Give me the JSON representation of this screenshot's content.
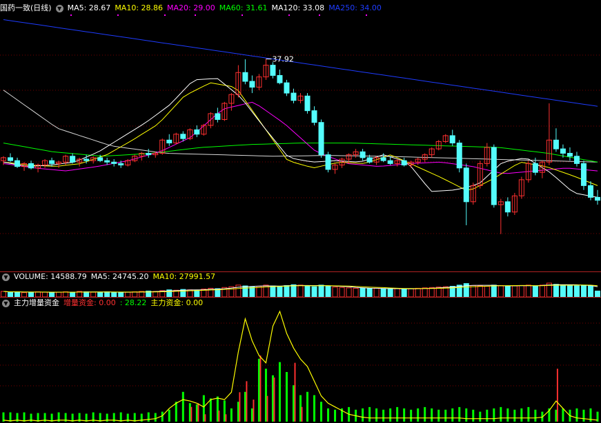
{
  "main_header": {
    "title": "国药一致(日线)",
    "items": [
      {
        "label": "MA5: 28.67",
        "color": "#ffffff"
      },
      {
        "label": "MA10: 28.86",
        "color": "#ffff00"
      },
      {
        "label": "MA20: 29.00",
        "color": "#ff00ff"
      },
      {
        "label": "MA60: 31.61",
        "color": "#00ff00"
      },
      {
        "label": "MA120: 33.08",
        "color": "#ffffff"
      },
      {
        "label": "MA250: 34.00",
        "color": "#1e3cff"
      }
    ]
  },
  "volume_header": {
    "title": "VOLUME: 14588.79",
    "items": [
      {
        "label": "MA5: 24745.20",
        "color": "#ffffff"
      },
      {
        "label": "MA10: 27991.57",
        "color": "#ffff00"
      }
    ]
  },
  "indicator_header": {
    "title": "主力增量资金",
    "items": [
      {
        "label": "增量资金: 0.00",
        "color": "#ff3030"
      },
      {
        "label": ": 28.22",
        "color": "#00ff00"
      },
      {
        "label": "主力资金: 0.00",
        "color": "#ffff00"
      }
    ]
  },
  "colors": {
    "up": "#ff3030",
    "down": "#54fcfc",
    "grid": "#7a0000",
    "ma5": "#ffffff",
    "ma10": "#ffff00",
    "ma20": "#ff00ff",
    "ma60": "#00ff00",
    "ma120": "#d8d8d8",
    "ma250": "#1e3cff"
  },
  "chart_data": [
    {
      "type": "candlestick",
      "series_name": "国药一致(日线)",
      "ylim": [
        23.5,
        41
      ],
      "grid": true,
      "annotations": [
        {
          "text": "37.92",
          "at_bar": 38
        }
      ],
      "ohlc": [
        [
          31.0,
          31.3,
          30.7,
          31.2
        ],
        [
          31.2,
          31.5,
          30.9,
          31.0
        ],
        [
          31.0,
          31.2,
          30.5,
          30.6
        ],
        [
          30.6,
          30.9,
          30.3,
          30.8
        ],
        [
          30.8,
          31.0,
          30.4,
          30.5
        ],
        [
          30.5,
          30.8,
          30.2,
          30.7
        ],
        [
          30.7,
          31.1,
          30.5,
          31.0
        ],
        [
          31.0,
          31.2,
          30.6,
          30.8
        ],
        [
          30.8,
          31.0,
          30.5,
          30.9
        ],
        [
          30.9,
          31.4,
          30.7,
          31.3
        ],
        [
          31.3,
          31.5,
          30.8,
          30.9
        ],
        [
          30.9,
          31.2,
          30.6,
          31.1
        ],
        [
          31.1,
          31.4,
          30.8,
          31.0
        ],
        [
          31.0,
          31.3,
          30.8,
          31.2
        ],
        [
          31.2,
          31.4,
          30.9,
          31.0
        ],
        [
          31.0,
          31.2,
          30.7,
          30.9
        ],
        [
          30.9,
          31.1,
          30.6,
          30.8
        ],
        [
          30.8,
          31.0,
          30.5,
          30.7
        ],
        [
          30.7,
          31.1,
          30.6,
          31.0
        ],
        [
          31.0,
          31.4,
          30.9,
          31.3
        ],
        [
          31.3,
          31.6,
          31.0,
          31.5
        ],
        [
          31.5,
          31.8,
          31.2,
          31.4
        ],
        [
          31.4,
          31.6,
          31.2,
          31.5
        ],
        [
          31.5,
          32.5,
          31.4,
          32.4
        ],
        [
          32.4,
          32.8,
          32.0,
          32.2
        ],
        [
          32.2,
          32.9,
          32.1,
          32.8
        ],
        [
          32.8,
          33.0,
          32.3,
          32.5
        ],
        [
          32.5,
          33.2,
          32.4,
          33.1
        ],
        [
          33.1,
          33.4,
          32.6,
          32.8
        ],
        [
          32.8,
          33.5,
          32.7,
          33.4
        ],
        [
          33.4,
          34.3,
          33.2,
          34.2
        ],
        [
          34.2,
          34.6,
          33.6,
          33.8
        ],
        [
          33.8,
          35.0,
          33.7,
          34.9
        ],
        [
          34.9,
          35.6,
          34.4,
          35.5
        ],
        [
          35.5,
          37.5,
          35.3,
          37.0
        ],
        [
          37.0,
          37.9,
          36.2,
          36.4
        ],
        [
          36.4,
          36.8,
          35.6,
          36.0
        ],
        [
          36.0,
          36.9,
          35.8,
          36.7
        ],
        [
          36.7,
          37.92,
          36.5,
          37.5
        ],
        [
          37.5,
          37.7,
          36.6,
          36.8
        ],
        [
          36.8,
          37.2,
          36.2,
          36.3
        ],
        [
          36.3,
          36.5,
          35.4,
          35.6
        ],
        [
          35.6,
          35.9,
          34.9,
          35.1
        ],
        [
          35.1,
          35.6,
          34.9,
          35.4
        ],
        [
          35.4,
          35.6,
          34.2,
          34.4
        ],
        [
          34.4,
          34.7,
          33.4,
          33.6
        ],
        [
          33.6,
          33.8,
          31.2,
          31.4
        ],
        [
          31.4,
          31.6,
          30.2,
          30.4
        ],
        [
          30.4,
          30.8,
          30.1,
          30.7
        ],
        [
          30.7,
          31.2,
          30.5,
          31.1
        ],
        [
          31.1,
          31.5,
          30.8,
          31.4
        ],
        [
          31.4,
          31.8,
          31.2,
          31.6
        ],
        [
          31.6,
          31.8,
          31.0,
          31.2
        ],
        [
          31.2,
          31.4,
          30.8,
          30.9
        ],
        [
          30.9,
          31.3,
          30.7,
          31.2
        ],
        [
          31.2,
          31.5,
          30.9,
          31.0
        ],
        [
          31.0,
          31.3,
          30.7,
          30.8
        ],
        [
          30.8,
          31.1,
          30.6,
          31.0
        ],
        [
          31.0,
          31.2,
          30.6,
          30.7
        ],
        [
          30.7,
          31.0,
          30.5,
          30.9
        ],
        [
          30.9,
          31.2,
          30.7,
          31.1
        ],
        [
          31.1,
          31.5,
          30.9,
          31.4
        ],
        [
          31.4,
          31.9,
          31.2,
          31.8
        ],
        [
          31.8,
          32.4,
          31.7,
          32.3
        ],
        [
          32.3,
          32.8,
          32.2,
          32.7
        ],
        [
          32.7,
          33.1,
          32.0,
          32.2
        ],
        [
          32.2,
          32.4,
          30.2,
          30.5
        ],
        [
          30.5,
          30.8,
          26.6,
          28.2
        ],
        [
          28.2,
          29.5,
          28.0,
          29.3
        ],
        [
          29.3,
          31.0,
          29.1,
          30.8
        ],
        [
          30.8,
          32.2,
          30.6,
          31.9
        ],
        [
          31.9,
          32.1,
          27.8,
          28.0
        ],
        [
          28.0,
          28.4,
          26.0,
          28.2
        ],
        [
          28.2,
          28.5,
          27.2,
          27.5
        ],
        [
          27.5,
          28.8,
          27.3,
          28.6
        ],
        [
          28.6,
          29.9,
          28.4,
          29.7
        ],
        [
          29.7,
          31.0,
          29.5,
          30.8
        ],
        [
          30.8,
          31.2,
          30.0,
          30.2
        ],
        [
          30.2,
          31.0,
          29.8,
          30.9
        ],
        [
          30.9,
          34.9,
          30.7,
          32.4
        ],
        [
          32.4,
          33.2,
          31.6,
          31.8
        ],
        [
          31.8,
          32.1,
          31.2,
          31.5
        ],
        [
          31.5,
          31.9,
          31.0,
          31.3
        ],
        [
          31.3,
          31.6,
          30.6,
          30.8
        ],
        [
          30.8,
          31.0,
          29.0,
          29.3
        ],
        [
          29.3,
          29.6,
          28.3,
          28.5
        ],
        [
          28.5,
          29.0,
          28.0,
          28.3
        ]
      ],
      "ma": {
        "MA250": [
          40.6,
          34.7
        ],
        "MA120": [
          35.8,
          33.2,
          32.0,
          31.5,
          31.4,
          31.3,
          31.35,
          31.3,
          31.2,
          31.1,
          31.0,
          30.9
        ],
        "MA60": [
          32.2,
          31.6,
          31.3,
          31.5,
          31.9,
          32.1,
          32.2,
          32.2,
          32.1,
          32.0,
          31.9,
          31.5,
          30.9
        ],
        "MA20": [
          30.8,
          30.5,
          30.3,
          30.6,
          31.0,
          31.6,
          32.6,
          34.5,
          35.0,
          33.5,
          31.6,
          30.8,
          30.6,
          30.8,
          30.9,
          30.6,
          30.1,
          30.3,
          30.5,
          30.3
        ],
        "MA10": [
          30.9,
          30.7,
          30.6,
          30.8,
          31.4,
          32.4,
          33.5,
          35.4,
          36.3,
          36.0,
          33.5,
          31.0,
          30.5,
          30.9,
          30.8,
          31.4,
          30.6,
          29.8,
          28.9,
          29.8,
          30.9,
          30.6,
          30.0,
          29.3
        ],
        "MA5": [
          30.9,
          30.6,
          30.7,
          30.9,
          31.6,
          32.6,
          33.6,
          34.8,
          36.5,
          36.6,
          35.3,
          33.2,
          31.2,
          30.9,
          31.0,
          30.9,
          31.4,
          30.9,
          28.9,
          29.0,
          29.4,
          30.9,
          31.2,
          30.2,
          28.8,
          28.5
        ]
      }
    },
    {
      "type": "bar",
      "series_name": "VOLUME",
      "values": [
        14,
        12,
        13,
        11,
        12,
        13,
        12,
        11,
        12,
        13,
        12,
        14,
        13,
        12,
        12,
        13,
        12,
        11,
        12,
        13,
        14,
        15,
        14,
        16,
        18,
        17,
        19,
        18,
        17,
        20,
        22,
        21,
        24,
        26,
        30,
        28,
        26,
        27,
        30,
        28,
        27,
        29,
        31,
        30,
        28,
        26,
        30,
        28,
        25,
        24,
        23,
        22,
        22,
        21,
        22,
        21,
        20,
        21,
        20,
        21,
        22,
        23,
        24,
        25,
        26,
        27,
        30,
        34,
        29,
        28,
        27,
        30,
        29,
        27,
        28,
        29,
        30,
        28,
        30,
        35,
        32,
        30,
        29,
        28,
        30,
        28,
        15
      ]
    },
    {
      "type": "bar+line",
      "series": [
        {
          "name": "增量资金",
          "values": [
            0,
            0,
            0,
            0,
            0,
            0,
            0,
            0,
            0,
            0,
            0,
            0,
            0,
            0,
            0,
            0,
            0,
            0,
            0,
            0,
            0,
            0,
            0,
            0,
            0,
            0,
            0,
            20,
            25,
            10,
            0,
            15,
            10,
            0,
            40,
            55,
            30,
            90,
            35,
            60,
            0,
            0,
            80,
            20,
            0,
            0,
            0,
            0,
            0,
            0,
            0,
            0,
            0,
            0,
            0,
            0,
            0,
            0,
            0,
            0,
            0,
            0,
            0,
            0,
            0,
            0,
            0,
            0,
            0,
            0,
            0,
            0,
            0,
            0,
            0,
            0,
            0,
            0,
            0,
            0,
            72,
            0,
            0,
            0,
            0,
            0,
            0
          ]
        },
        {
          "name": "绿柱",
          "values": [
            14,
            14,
            13,
            14,
            12,
            13,
            13,
            12,
            14,
            13,
            12,
            13,
            12,
            14,
            13,
            12,
            13,
            14,
            12,
            13,
            12,
            14,
            13,
            15,
            18,
            30,
            45,
            28,
            26,
            40,
            35,
            38,
            32,
            20,
            30,
            45,
            20,
            95,
            80,
            70,
            90,
            75,
            55,
            40,
            45,
            40,
            30,
            20,
            18,
            20,
            22,
            18,
            20,
            22,
            20,
            18,
            20,
            22,
            20,
            18,
            20,
            22,
            20,
            18,
            18,
            20,
            22,
            20,
            18,
            15,
            18,
            20,
            22,
            20,
            18,
            20,
            22,
            18,
            15,
            20,
            18,
            20,
            18,
            20,
            18,
            20,
            15
          ]
        },
        {
          "name": "主力资金",
          "values": [
            2,
            1,
            2,
            1,
            2,
            1,
            2,
            1,
            2,
            2,
            1,
            2,
            1,
            2,
            1,
            2,
            2,
            1,
            2,
            1,
            2,
            3,
            4,
            8,
            18,
            25,
            30,
            28,
            25,
            20,
            30,
            32,
            30,
            40,
            95,
            140,
            110,
            90,
            80,
            130,
            150,
            120,
            100,
            85,
            75,
            55,
            35,
            25,
            20,
            15,
            10,
            8,
            6,
            5,
            5,
            5,
            5,
            5,
            5,
            5,
            5,
            5,
            5,
            5,
            5,
            5,
            5,
            4,
            4,
            4,
            4,
            4,
            5,
            5,
            5,
            5,
            5,
            5,
            6,
            15,
            28,
            18,
            8,
            5,
            4,
            3,
            2
          ]
        }
      ]
    }
  ]
}
